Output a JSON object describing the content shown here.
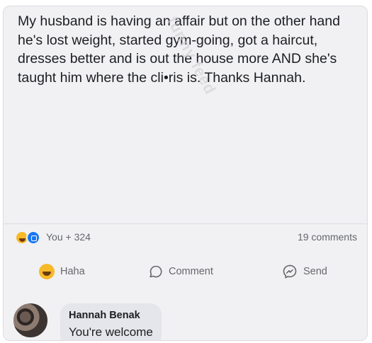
{
  "post": {
    "text": "My husband is having an affair but on the other hand he's lost weight, started gym-going, got a haircut, dresses better and is out the house more AND she's taught him where the cli•ris is. Thanks Hannah.",
    "watermark": "funny feed"
  },
  "reactions": {
    "icons": [
      "haha-icon",
      "like-icon"
    ],
    "summary": "You + 324",
    "comments": "19 comments"
  },
  "actions": {
    "haha": "Haha",
    "comment": "Comment",
    "send": "Send"
  },
  "comment": {
    "author": "Hannah Benak",
    "text": "You're welcome"
  },
  "colors": {
    "card_bg": "#f1f1f3",
    "bubble_bg": "#e4e6eb",
    "muted_text": "#65676b",
    "like_blue": "#1877f2",
    "haha_yellow": "#f7b928"
  }
}
